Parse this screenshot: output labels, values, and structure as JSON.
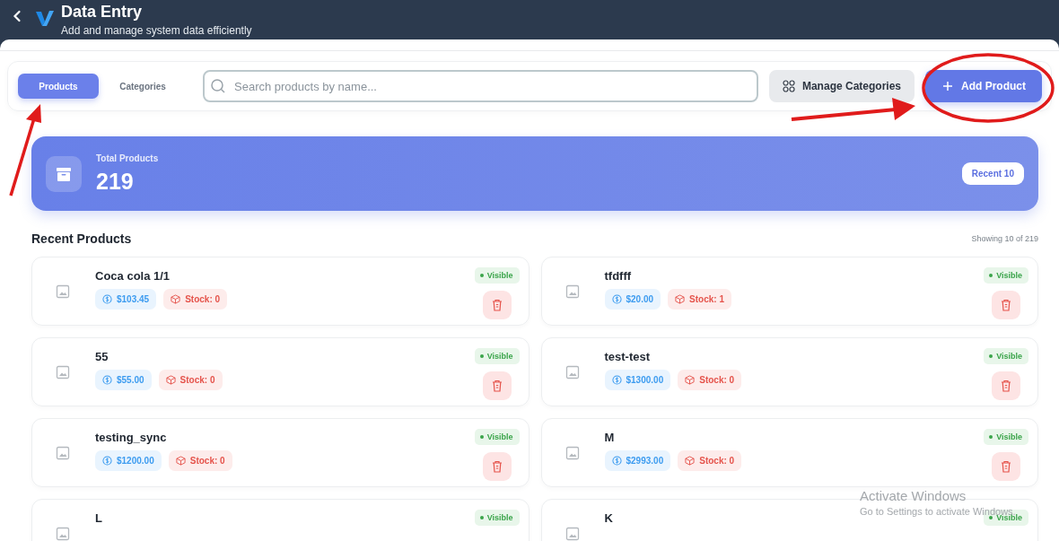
{
  "header": {
    "title": "Data Entry",
    "subtitle": "Add and manage system data efficiently"
  },
  "tabs": [
    {
      "label": "Products",
      "selected": true
    },
    {
      "label": "Categories",
      "selected": false
    }
  ],
  "search": {
    "placeholder": "Search products by name..."
  },
  "buttons": [
    {
      "kind": "secondary",
      "label": "Manage Categories"
    },
    {
      "kind": "primary",
      "label": "Add Product"
    }
  ],
  "summary": {
    "label": "Total Products",
    "value": "219",
    "badge": "Recent 10"
  },
  "list": {
    "title": "Recent Products",
    "count": "Showing 10 of 219"
  },
  "products": [
    {
      "name": "Coca cola 1/1",
      "price": "$103.45",
      "stock": "Stock: 0",
      "status": "Visible",
      "visible": true
    },
    {
      "name": "tfdfff",
      "price": "$20.00",
      "stock": "Stock: 1",
      "status": "Visible",
      "visible": true
    },
    {
      "name": "55",
      "price": "$55.00",
      "stock": "Stock: 0",
      "status": "Visible",
      "visible": true
    },
    {
      "name": "test-test",
      "price": "$1300.00",
      "stock": "Stock: 0",
      "status": "Visible",
      "visible": true
    },
    {
      "name": "testing_sync",
      "price": "$1200.00",
      "stock": "Stock: 0",
      "status": "Visible",
      "visible": true
    },
    {
      "name": "M",
      "price": "$2993.00",
      "stock": "Stock: 0",
      "status": "Visible",
      "visible": true
    },
    {
      "name": "L",
      "status": "Visible",
      "visible": true
    },
    {
      "name": "K",
      "status": "Visible",
      "visible": true
    }
  ],
  "annotations": [
    {
      "kind": "arrow"
    },
    {
      "kind": "arrow"
    },
    {
      "kind": "ellipse"
    }
  ],
  "os_notice": {
    "title": "Activate Windows",
    "subtitle": "Go to Settings to activate Windows."
  }
}
